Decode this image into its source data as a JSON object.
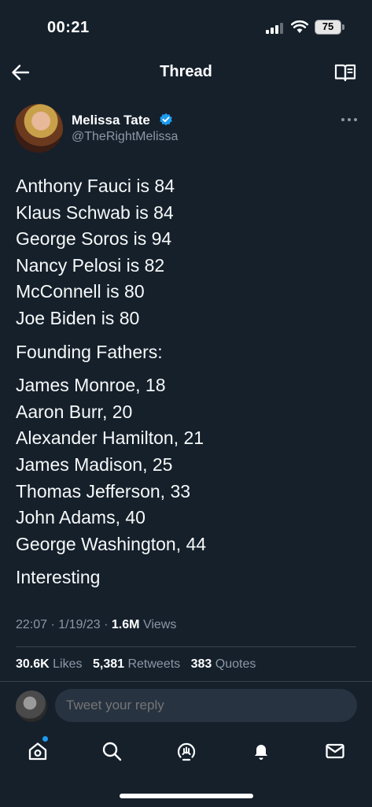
{
  "status_bar": {
    "time": "00:21",
    "battery": "75"
  },
  "header": {
    "title": "Thread"
  },
  "author": {
    "name": "Melissa Tate",
    "handle": "@TheRightMelissa"
  },
  "tweet": {
    "paragraphs": [
      [
        "Anthony Fauci is 84",
        "Klaus Schwab is 84",
        "George Soros is 94",
        "Nancy Pelosi is 82",
        "McConnell is 80",
        "Joe Biden is 80"
      ],
      [
        "Founding Fathers:"
      ],
      [
        "James Monroe, 18",
        "Aaron Burr, 20",
        "Alexander Hamilton, 21",
        "James Madison, 25",
        "Thomas Jefferson, 33",
        "John Adams, 40",
        "George Washington, 44"
      ],
      [
        "Interesting"
      ]
    ]
  },
  "meta": {
    "time": "22:07",
    "date": "1/19/23",
    "views_count": "1.6M",
    "views_label": "Views"
  },
  "stats": {
    "likes_count": "30.6K",
    "likes_label": "Likes",
    "retweets_count": "5,381",
    "retweets_label": "Retweets",
    "quotes_count": "383",
    "quotes_label": "Quotes"
  },
  "reply": {
    "placeholder": "Tweet your reply"
  },
  "colors": {
    "background": "#15202b",
    "accent": "#1d9bf0",
    "muted": "#8b98a5"
  }
}
